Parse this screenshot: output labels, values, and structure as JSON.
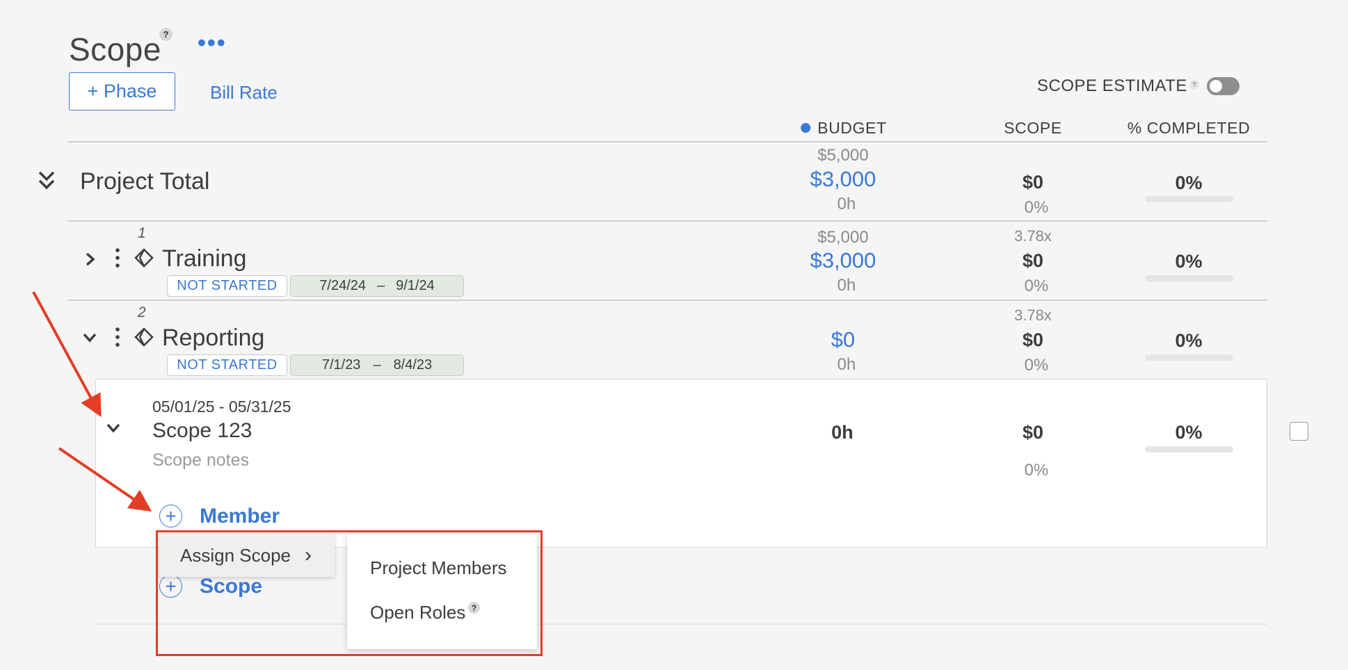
{
  "header": {
    "title": "Scope",
    "help_glyph": "?",
    "more_glyph": "•••",
    "phase_button": "+ Phase",
    "bill_rate": "Bill Rate",
    "scope_estimate": "SCOPE ESTIMATE",
    "scope_estimate_help": "?"
  },
  "columns": {
    "budget": "BUDGET",
    "scope": "SCOPE",
    "completed": "% COMPLETED"
  },
  "project_total": {
    "label": "Project Total",
    "budget_original": "$5,000",
    "budget": "$3,000",
    "budget_hours": "0h",
    "scope": "$0",
    "scope_pct": "0%",
    "completed": "0%"
  },
  "phases": [
    {
      "number": "1",
      "name": "Training",
      "status": "NOT STARTED",
      "start": "7/24/24",
      "dash": "–",
      "end": "9/1/24",
      "budget_original": "$5,000",
      "budget": "$3,000",
      "budget_hours": "0h",
      "multiplier": "3.78x",
      "scope": "$0",
      "scope_pct": "0%",
      "completed": "0%"
    },
    {
      "number": "2",
      "name": "Reporting",
      "status": "NOT STARTED",
      "start": "7/1/23",
      "dash": "–",
      "end": "8/4/23",
      "budget": "$0",
      "budget_hours": "0h",
      "multiplier": "3.78x",
      "scope": "$0",
      "scope_pct": "0%",
      "completed": "0%"
    }
  ],
  "scope_item": {
    "dates": "05/01/25 - 05/31/25",
    "title": "Scope 123",
    "notes": "Scope notes",
    "hours": "0h",
    "scope": "$0",
    "scope_pct": "0%",
    "completed": "0%"
  },
  "add_member": {
    "plus": "+",
    "label": "Member"
  },
  "add_scope": {
    "plus": "+",
    "label": "Scope"
  },
  "context_menu": {
    "assign_scope": "Assign Scope",
    "chevron": "›",
    "submenu": [
      "Project Members",
      "Open Roles"
    ],
    "open_roles_help": "?"
  },
  "colors": {
    "accent": "#3a78d6",
    "annotation": "#e43d26",
    "date_badge": "#e2e9e0"
  }
}
